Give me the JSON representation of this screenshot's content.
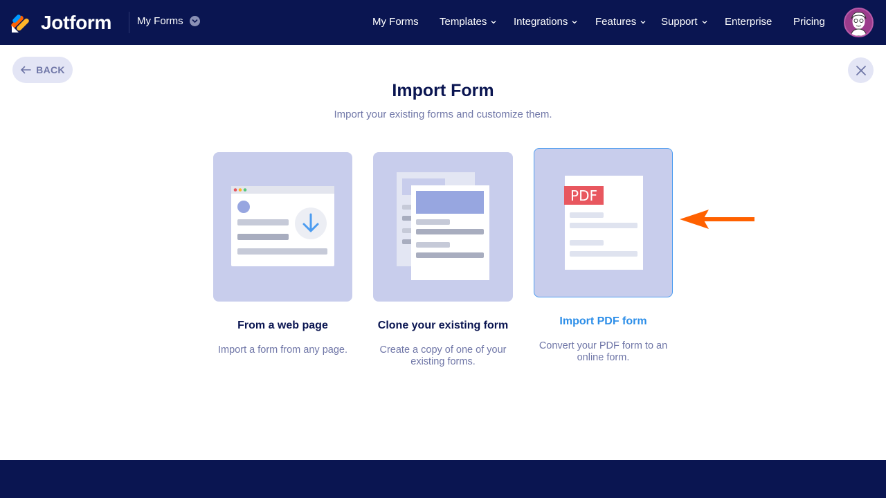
{
  "header": {
    "brand": "Jotform",
    "workspace_dropdown": "My Forms",
    "nav": [
      {
        "label": "My Forms",
        "has_chevron": false
      },
      {
        "label": "Templates",
        "has_chevron": true
      },
      {
        "label": "Integrations",
        "has_chevron": true
      },
      {
        "label": "Features",
        "has_chevron": true
      },
      {
        "label": "Support",
        "has_chevron": true
      },
      {
        "label": "Enterprise",
        "has_chevron": false
      },
      {
        "label": "Pricing",
        "has_chevron": false
      }
    ],
    "avatar_icon": "user-avatar-icon"
  },
  "back_label": "BACK",
  "close_icon": "close-icon",
  "page": {
    "title": "Import Form",
    "subtitle": "Import your existing forms and customize them."
  },
  "options": [
    {
      "title": "From a web page",
      "description": "Import a form from any page.",
      "selected": false
    },
    {
      "title": "Clone your existing form",
      "description": "Create a copy of one of your existing forms.",
      "selected": false
    },
    {
      "title": "Import PDF form",
      "description": "Convert your PDF form to an online form.",
      "selected": true,
      "badge": "PDF"
    }
  ],
  "colors": {
    "navy": "#0a1551",
    "card_bg": "#c8cdec",
    "active_blue": "#2c8ee8",
    "pdf_red": "#e8575f",
    "pointer_orange": "#ff6100"
  }
}
